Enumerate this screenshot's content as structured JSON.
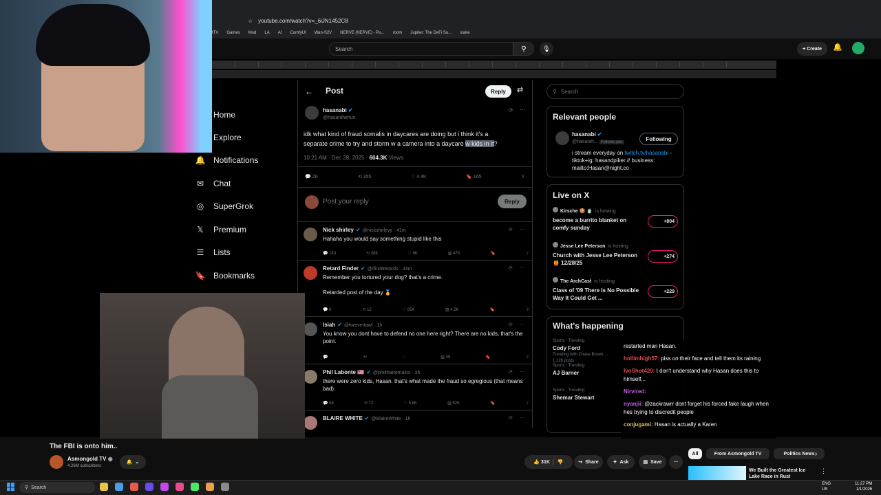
{
  "browser": {
    "url": "youtube.com/watch?v=_6iJN1452C8",
    "bookmarks": [
      "tTV",
      "Games",
      "Mod",
      "LA",
      "AI",
      "ComfyUI",
      "Wan-S2V",
      "NERVE (NERVE) - Pu...",
      "room",
      "Jupiter: The DeFi Su...",
      "stake"
    ]
  },
  "youtube_header": {
    "search_placeholder": "Search",
    "create_label": "Create"
  },
  "x_nav": {
    "items": [
      {
        "label": "Home",
        "icon": "home-icon"
      },
      {
        "label": "Explore",
        "icon": "search-icon"
      },
      {
        "label": "Notifications",
        "icon": "bell-icon"
      },
      {
        "label": "Chat",
        "icon": "mail-icon"
      },
      {
        "label": "SuperGrok",
        "icon": "grok-icon"
      },
      {
        "label": "Premium",
        "icon": "x-icon"
      },
      {
        "label": "Lists",
        "icon": "list-icon"
      },
      {
        "label": "Bookmarks",
        "icon": "bookmark-icon"
      }
    ]
  },
  "post": {
    "header_title": "Post",
    "reply_button": "Reply",
    "author_name": "hasanabi",
    "author_handle": "@hasanthehun",
    "text_line1": "idk what kind of fraud somalis in daycares are doing but i think it's a",
    "text_line2_a": "separate crime to try and storm w a camera into a daycare ",
    "text_line2_highlight": "w kids in it",
    "text_line2_end": "?",
    "timestamp": "10:21 AM · Dec 28, 2025 · ",
    "views_count": "604.3K",
    "views_label": " Views",
    "stats": {
      "replies": "2K",
      "reposts": "355",
      "likes": "4.4K",
      "bookmarks": "165"
    },
    "reply_placeholder": "Post your reply",
    "reply_submit": "Reply"
  },
  "replies": [
    {
      "name": "Nick shirley",
      "handle": "@nickshirleyy · 41m",
      "text": "Hahaha you would say something stupid like this",
      "stats": [
        "143",
        "288",
        "9K",
        "47K"
      ],
      "color": "#6b5a4a"
    },
    {
      "name": "Retard Finder",
      "handle": "@IfindRetards · 33m",
      "text": "Remember you tortured your dog? that's a crime.\n\nRetarded post of the day 🏅",
      "stats": [
        "8",
        "12",
        "854",
        "4.2K"
      ],
      "color": "#c0392b"
    },
    {
      "name": "Isiah",
      "handle": "@forevertawl · 1h",
      "text": "You know you dont have to defend no one here right? There are no kids, that's the point.",
      "stats": [
        "",
        "",
        "",
        "39"
      ],
      "color": "#555"
    },
    {
      "name": "Phil Labonte 🇺🇸",
      "handle": "@philthatremains · 3h",
      "text": "there were zero kids, Hasan. that's what made the fraud so egregious (that means bad).",
      "stats": [
        "58",
        "72",
        "5.8K",
        "52K"
      ],
      "color": "#8a7a6a"
    },
    {
      "name": "BLAIRE WHITE",
      "handle": "@BlaireWhite · 1h",
      "text": "",
      "stats": [],
      "color": "#a77"
    }
  ],
  "right_col": {
    "search_placeholder": "Search",
    "relevant_title": "Relevant people",
    "rp_name": "hasanabi",
    "rp_handle": "@hasanth...",
    "rp_follows": "Follows you",
    "rp_button": "Following",
    "rp_bio_1": "i stream everyday on ",
    "rp_bio_link": "twitch.tv/hasanabi",
    "rp_bio_2": " - tiktok+ig: hasandpiker // business: mailto:Hasan@night.co",
    "live_title": "Live on X",
    "live": [
      {
        "host": "Kirsche 🍪 🍵",
        "status": "is hosting",
        "title": "become a burrito blanket on comfy sunday",
        "count": "+804"
      },
      {
        "host": "Jesse Lee Peterson",
        "status": "is hosting",
        "title": "Church with Jesse Lee Peterson 🍯 12/28/25",
        "count": "+274"
      },
      {
        "host": "The ArchCast",
        "status": "is hosting",
        "title": "Class of '09 There Is No Possible Way It Could Get ...",
        "count": "+229"
      }
    ],
    "happening_title": "What's happening",
    "trends": [
      {
        "meta": "Sports · Trending",
        "name": "Cody Ford",
        "extra": "Trending with Chase Brown, ...",
        "posts": "1,126 posts"
      },
      {
        "meta": "Sports · Trending",
        "name": "AJ Barner",
        "extra": "",
        "posts": ""
      },
      {
        "meta": "Sports · Trending",
        "name": "Shemar Stewart",
        "extra": "",
        "posts": ""
      }
    ]
  },
  "chat": [
    {
      "user": "",
      "msg": "restarted man Hasan.",
      "color": "#fff"
    },
    {
      "user": "hollimhigh57:",
      "msg": " piss on their face and tell them its raining",
      "color": "#e05050"
    },
    {
      "user": "IvoShot420:",
      "msg": " I don't understand why Hasan does this to himself...",
      "color": "#e05050"
    },
    {
      "user": "Nirvired:",
      "msg": "",
      "color": "#c060e0"
    },
    {
      "user": "nyanjii:",
      "msg": " @zackrawrr dont forget his forced fake laugh when hes trying to discredit people",
      "color": "#c060e0"
    },
    {
      "user": "conjugami:",
      "msg": " Hasan is actually a Karen",
      "color": "#e0c060"
    }
  ],
  "video": {
    "title": "The FBI is onto him..",
    "channel": "Asmongold TV",
    "subscribers": "4.26M subscribers",
    "likes": "31K",
    "share": "Share",
    "ask": "Ask",
    "save": "Save",
    "chips": [
      "All",
      "From Asmongold TV",
      "Politics News"
    ],
    "rec_title": "We Built the Greatest Ice Lake Race in Rust"
  },
  "taskbar": {
    "search": "Search",
    "lang": "ENG\nUS",
    "time": "11:27 PM",
    "date": "1/1/2026"
  },
  "colors": {
    "accent": "#1d9bf0",
    "like": "#f91880",
    "yt_bg": "#0f0f0f"
  }
}
